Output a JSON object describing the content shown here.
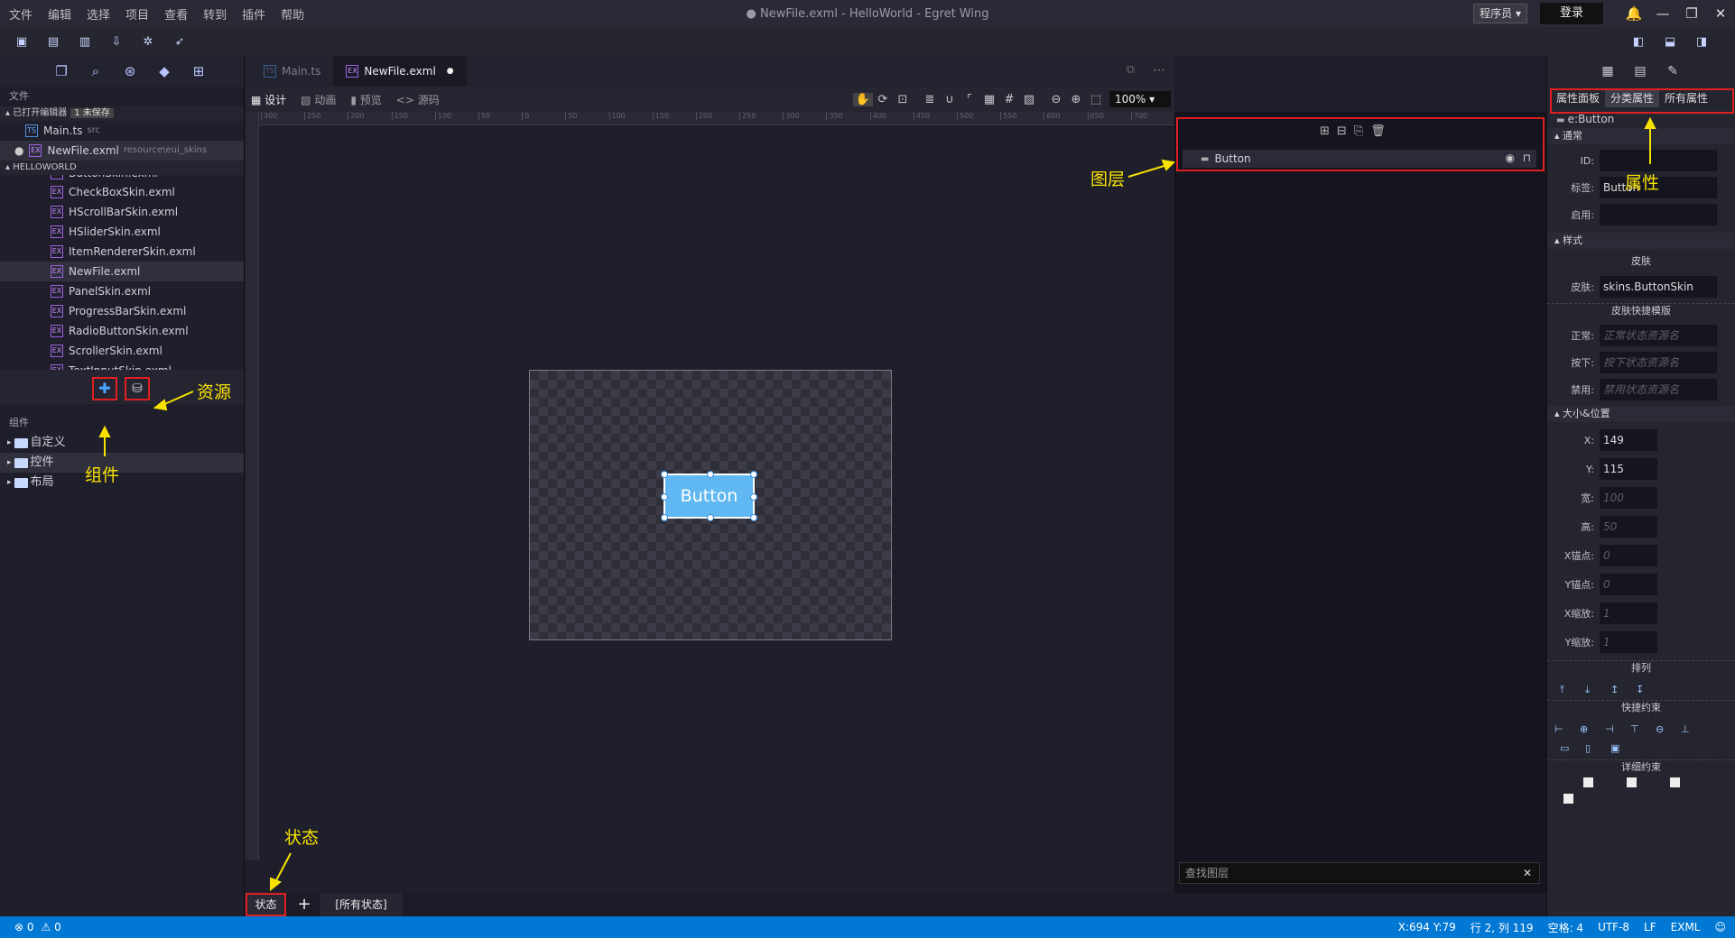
{
  "menu": [
    "文件",
    "编辑",
    "选择",
    "项目",
    "查看",
    "转到",
    "插件",
    "帮助"
  ],
  "window_title": "● NewFile.exml - HelloWorld - Egret Wing",
  "role": "程序员",
  "login_label": "登录",
  "left": {
    "section_files": "文件",
    "open_editors": {
      "title": "已打开编辑器",
      "badge": "1 未保存"
    },
    "open_files": [
      {
        "name": "Main.ts",
        "path": "src"
      },
      {
        "name": "NewFile.exml",
        "path": "resource\\eui_skins"
      }
    ],
    "project": "HELLOWORLD",
    "project_files": [
      "ButtonSkin.exml",
      "CheckBoxSkin.exml",
      "HScrollBarSkin.exml",
      "HSliderSkin.exml",
      "ItemRendererSkin.exml",
      "NewFile.exml",
      "PanelSkin.exml",
      "ProgressBarSkin.exml",
      "RadioButtonSkin.exml",
      "ScrollerSkin.exml",
      "TextInputSkin.exml"
    ],
    "section_components": "组件",
    "components": [
      "自定义",
      "控件",
      "布局"
    ]
  },
  "tabs": [
    "Main.ts",
    "NewFile.exml"
  ],
  "modes": [
    "设计",
    "动画",
    "预览",
    "源码"
  ],
  "zoom": "100%",
  "ruler_labels": [
    "300",
    "250",
    "200",
    "150",
    "100",
    "50",
    "0",
    "50",
    "100",
    "150",
    "200",
    "250",
    "300",
    "350",
    "400",
    "450",
    "500",
    "550",
    "600",
    "650",
    "700"
  ],
  "canvas": {
    "button_label": "Button"
  },
  "layers": {
    "item": "Button",
    "find_placeholder": "查找图层"
  },
  "props": {
    "tabs": [
      "属性面板",
      "分类属性",
      "所有属性"
    ],
    "element_class": "e:Button",
    "group_common": "通常",
    "id_label": "ID:",
    "label_label": "标签:",
    "label_value": "Button",
    "enabled_label": "启用:",
    "group_style": "样式",
    "skin_section": "皮肤",
    "skin_label": "皮肤:",
    "skin_value": "skins.ButtonSkin",
    "skin_template": "皮肤快捷模版",
    "normal_label": "正常:",
    "normal_ph": "正常状态资源名",
    "down_label": "按下:",
    "down_ph": "按下状态资源名",
    "disabled_label": "禁用:",
    "disabled_ph": "禁用状态资源名",
    "group_size": "大小&位置",
    "x_label": "X:",
    "x_value": "149",
    "y_label": "Y:",
    "y_value": "115",
    "w_label": "宽:",
    "w_ph": "100",
    "h_label": "高:",
    "h_ph": "50",
    "ax_label": "X锚点:",
    "ax_ph": "0",
    "ay_label": "Y锚点:",
    "ay_ph": "0",
    "sx_label": "X缩放:",
    "sx_ph": "1",
    "sy_label": "Y缩放:",
    "sy_ph": "1",
    "arrange": "排列",
    "quick_constraint": "快捷约束",
    "detail_constraint": "详细约束"
  },
  "states": {
    "label": "状态",
    "all": "[所有状态]"
  },
  "status": {
    "errors": "⊗ 0",
    "warnings": "⚠ 0",
    "pos": "X:694 Y:79",
    "line": "行 2, 列 119",
    "spaces": "空格: 4",
    "enc": "UTF-8",
    "eol": "LF",
    "lang": "EXML"
  },
  "annotations": {
    "layers": "图层",
    "props": "属性",
    "resources": "资源",
    "components": "组件",
    "states": "状态"
  }
}
